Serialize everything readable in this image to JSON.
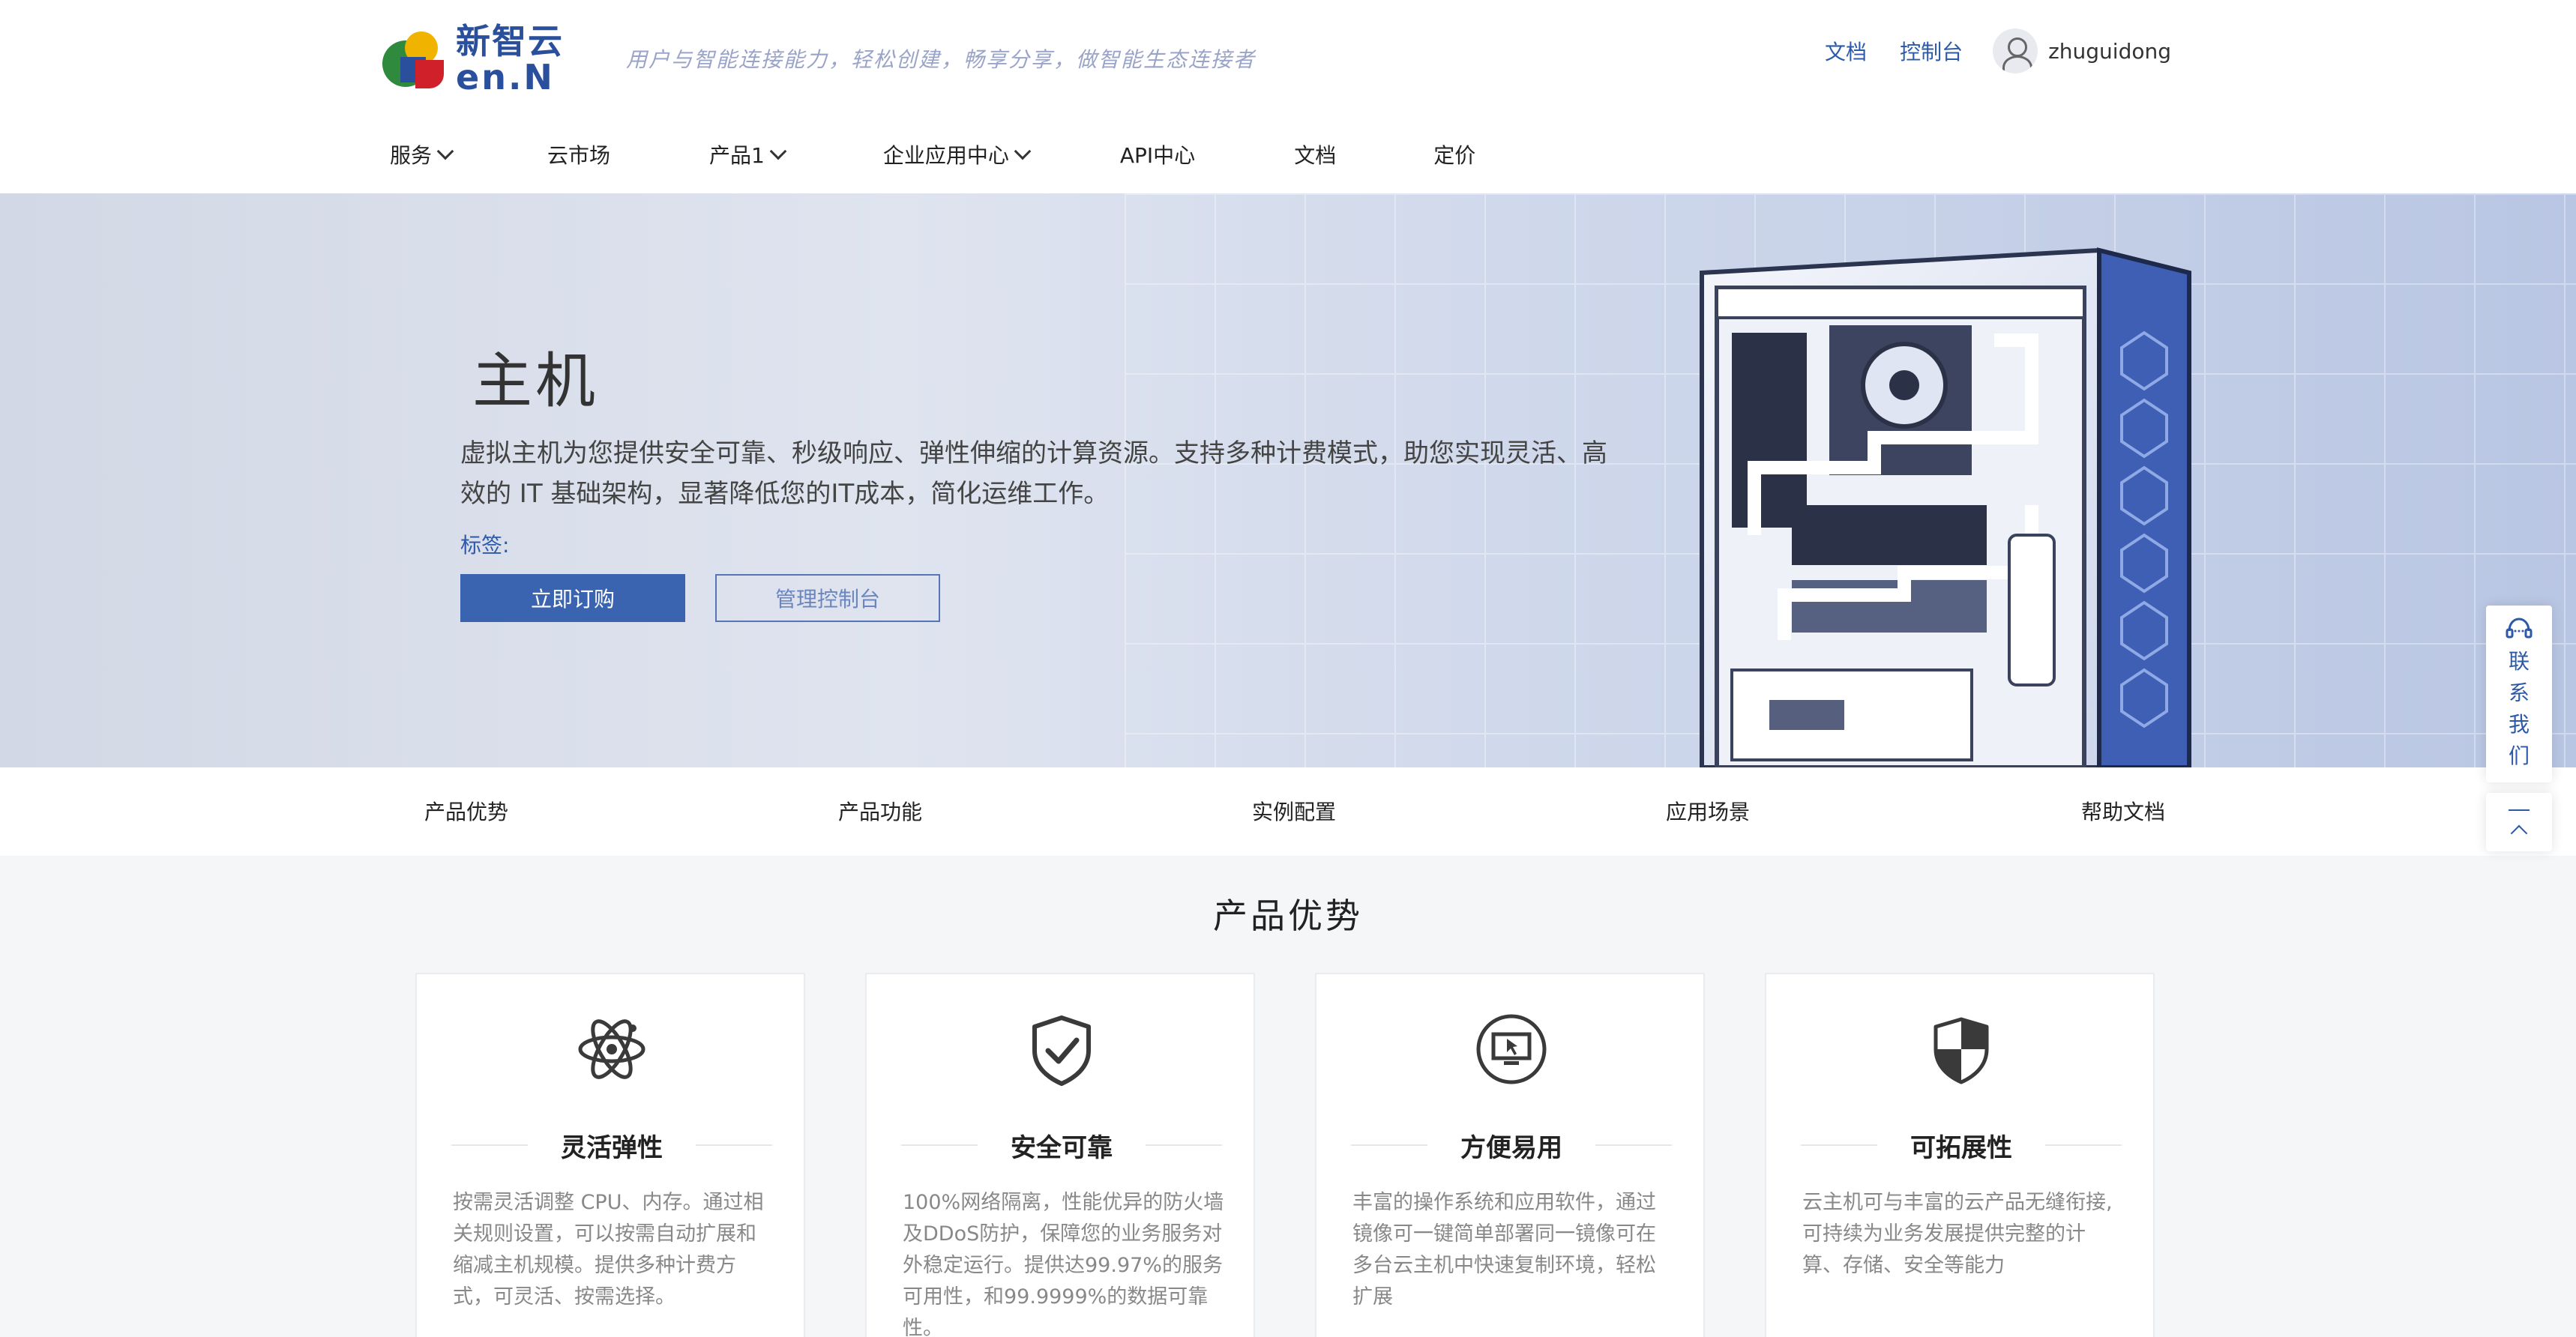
{
  "brand": {
    "logo_cn": "新智云",
    "logo_en": "en.N",
    "slogan": "用户与智能连接能力，轻松创建，畅享分享，做智能生态连接者"
  },
  "top_links": {
    "docs": "文档",
    "console": "控制台",
    "username": "zhuguidong"
  },
  "nav": [
    {
      "label": "服务",
      "has_dropdown": true
    },
    {
      "label": "云市场",
      "has_dropdown": false
    },
    {
      "label": "产品1",
      "has_dropdown": true
    },
    {
      "label": "企业应用中心",
      "has_dropdown": true
    },
    {
      "label": "API中心",
      "has_dropdown": false
    },
    {
      "label": "文档",
      "has_dropdown": false
    },
    {
      "label": "定价",
      "has_dropdown": false
    }
  ],
  "hero": {
    "title": "主机",
    "description": "虚拟主机为您提供安全可靠、秒级响应、弹性伸缩的计算资源。支持多种计费模式，助您实现灵活、高效的 IT 基础架构，显著降低您的IT成本，简化运维工作。",
    "tag_label": "标签:",
    "buy_button": "立即订购",
    "console_button": "管理控制台"
  },
  "subnav": [
    "产品优势",
    "产品功能",
    "实例配置",
    "应用场景",
    "帮助文档"
  ],
  "section": {
    "title": "产品优势"
  },
  "cards": [
    {
      "icon": "atom-icon",
      "title": "灵活弹性",
      "desc": "按需灵活调整 CPU、内存。通过相关规则设置，可以按需自动扩展和缩减主机规模。提供多种计费方式，可灵活、按需选择。"
    },
    {
      "icon": "shield-check-icon",
      "title": "安全可靠",
      "desc": "100%网络隔离，性能优异的防火墙及DDoS防护，保障您的业务服务对外稳定运行。提供达99.97%的服务可用性，和99.9999%的数据可靠性。"
    },
    {
      "icon": "monitor-icon",
      "title": "方便易用",
      "desc": "丰富的操作系统和应用软件，通过镜像可一键简单部署同一镜像可在多台云主机中快速复制环境，轻松扩展"
    },
    {
      "icon": "shield-half-icon",
      "title": "可拓展性",
      "desc": "云主机可与丰富的云产品无缝衔接,可持续为业务发展提供完整的计算、存储、安全等能力"
    }
  ],
  "float": {
    "contact_label": "联系我们"
  },
  "colors": {
    "brand_blue": "#2d5aa8",
    "primary_button": "#3a64b0"
  }
}
